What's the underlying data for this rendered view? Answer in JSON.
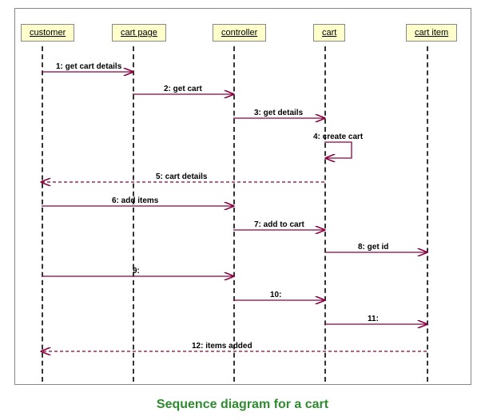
{
  "title": "Sequence diagram for a cart",
  "lifelines": {
    "customer": "customer",
    "cartpage": "cart page",
    "controller": "controller",
    "cart": "cart",
    "cartitem": "cart item"
  },
  "messages": {
    "m1": "1: get cart details",
    "m2": "2: get cart",
    "m3": "3: get details",
    "m4": "4: create cart",
    "m5": "5: cart details",
    "m6": "6: add items",
    "m7": "7: add to cart",
    "m8": "8: get id",
    "m9": "9:",
    "m10": "10:",
    "m11": "11:",
    "m12": "12: items added"
  },
  "chart_data": {
    "type": "sequence_diagram",
    "participants": [
      "customer",
      "cart page",
      "controller",
      "cart",
      "cart item"
    ],
    "interactions": [
      {
        "n": 1,
        "from": "customer",
        "to": "cart page",
        "label": "get cart details",
        "return": false
      },
      {
        "n": 2,
        "from": "cart page",
        "to": "controller",
        "label": "get cart",
        "return": false
      },
      {
        "n": 3,
        "from": "controller",
        "to": "cart",
        "label": "get details",
        "return": false
      },
      {
        "n": 4,
        "from": "cart",
        "to": "cart",
        "label": "create cart",
        "return": false,
        "self": true
      },
      {
        "n": 5,
        "from": "cart",
        "to": "customer",
        "label": "cart details",
        "return": true
      },
      {
        "n": 6,
        "from": "customer",
        "to": "controller",
        "label": "add items",
        "return": false
      },
      {
        "n": 7,
        "from": "controller",
        "to": "cart",
        "label": "add to cart",
        "return": false
      },
      {
        "n": 8,
        "from": "cart",
        "to": "cart item",
        "label": "get id",
        "return": false
      },
      {
        "n": 9,
        "from": "customer",
        "to": "controller",
        "label": "",
        "return": false
      },
      {
        "n": 10,
        "from": "controller",
        "to": "cart",
        "label": "",
        "return": false
      },
      {
        "n": 11,
        "from": "cart",
        "to": "cart item",
        "label": "",
        "return": false
      },
      {
        "n": 12,
        "from": "cart item",
        "to": "customer",
        "label": "items added",
        "return": true
      }
    ]
  }
}
